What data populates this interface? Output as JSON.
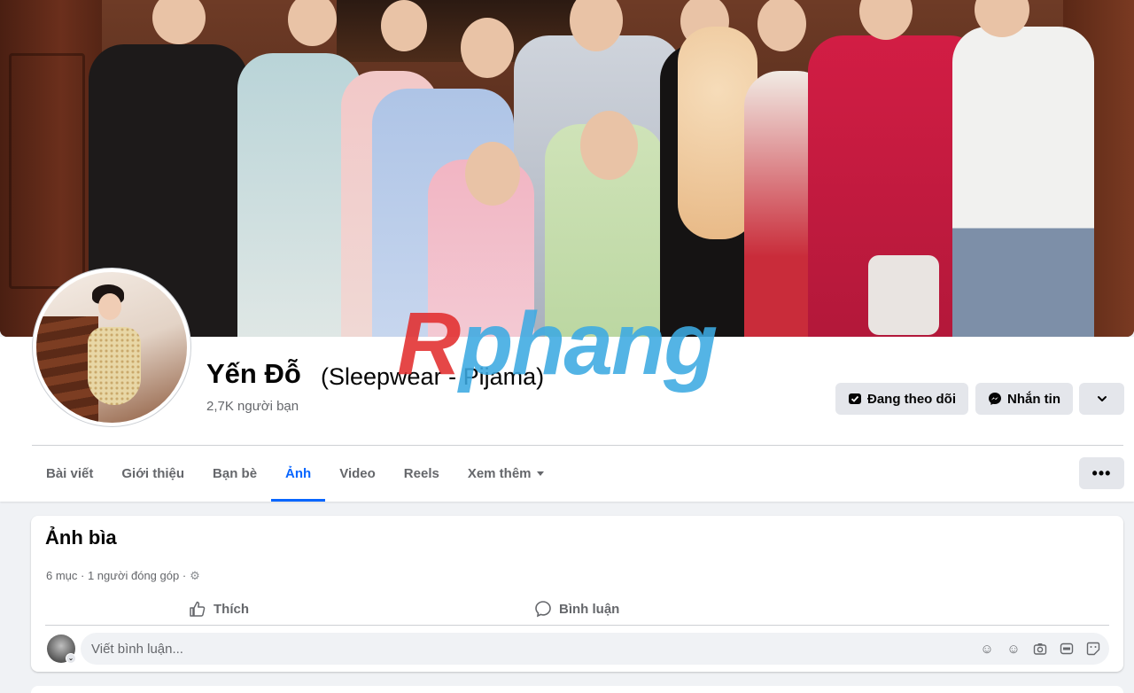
{
  "profile": {
    "name": "Yến Đỗ",
    "alternate_name": "(Sleepwear - Pijama)",
    "friends": "2,7K người bạn"
  },
  "actions": {
    "follow_label": "Đang theo dõi",
    "message_label": "Nhắn tin",
    "more_icon": "chevron-down-icon"
  },
  "tabs": [
    {
      "label": "Bài viết"
    },
    {
      "label": "Giới thiệu"
    },
    {
      "label": "Bạn bè"
    },
    {
      "label": "Ảnh"
    },
    {
      "label": "Video"
    },
    {
      "label": "Reels"
    },
    {
      "label": "Xem thêm"
    }
  ],
  "active_tab": "Ảnh",
  "album": {
    "title": "Ảnh bìa",
    "meta": "6 mục · 1 người đóng góp ·",
    "like_label": "Thích",
    "comment_label": "Bình luận",
    "comment_placeholder": "Viết bình luận..."
  },
  "watermark": {
    "r": "R",
    "rest": "phang"
  },
  "colors": {
    "accent": "#0866ff",
    "button_bg": "#e4e6eb",
    "page_bg": "#f0f2f5",
    "secondary_text": "#65676b"
  }
}
